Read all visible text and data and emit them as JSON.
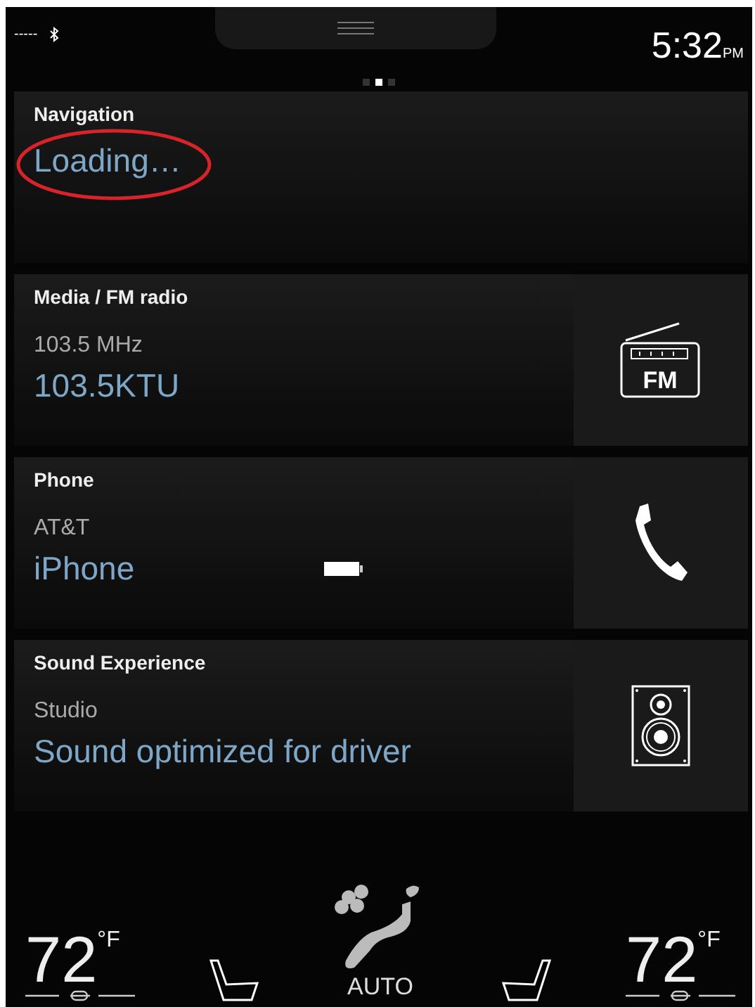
{
  "status_bar": {
    "signal": "-----",
    "time": "5:32",
    "time_suffix": "PM"
  },
  "page_dots": [
    {
      "selected": false
    },
    {
      "selected": true
    },
    {
      "selected": false
    }
  ],
  "tiles": [
    {
      "kind": "navigation",
      "title": "Navigation",
      "primary": "Loading…",
      "highlighted": true
    },
    {
      "kind": "radio",
      "title": "Media / FM radio",
      "secondary": "103.5 MHz",
      "primary": "103.5KTU",
      "icon_label": "FM"
    },
    {
      "kind": "phone",
      "title": "Phone",
      "secondary": "AT&T",
      "primary": "iPhone"
    },
    {
      "kind": "sound",
      "title": "Sound Experience",
      "secondary": "Studio",
      "primary": "Sound optimized for driver"
    }
  ],
  "climate": {
    "left": {
      "temp": "72",
      "unit": "°F"
    },
    "mode": "AUTO",
    "right": {
      "temp": "72",
      "unit": "°F"
    }
  }
}
